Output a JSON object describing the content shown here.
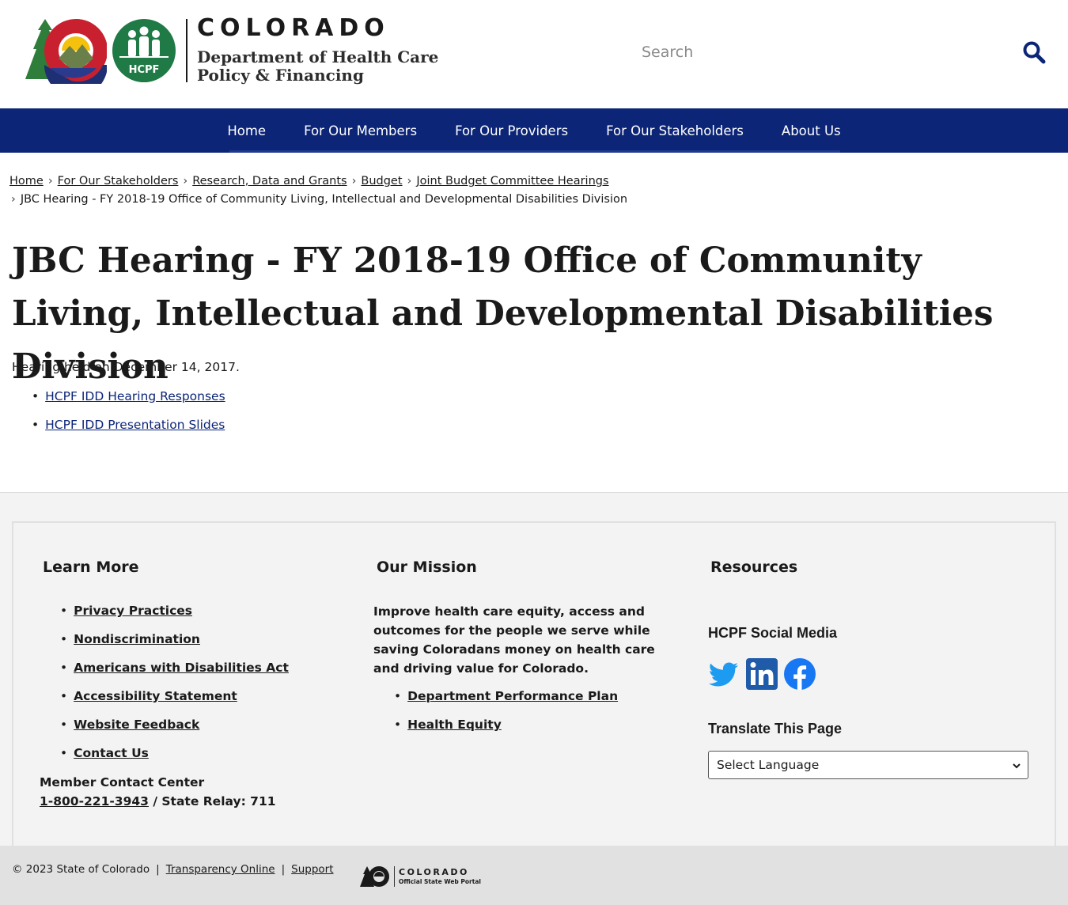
{
  "header": {
    "state_name": "COLORADO",
    "dept_line1": "Department of Health Care",
    "dept_line2": "Policy & Financing",
    "hcpf_badge": "HCPF",
    "search_placeholder": "Search"
  },
  "nav": {
    "items": [
      "Home",
      "For Our Members",
      "For Our Providers",
      "For Our Stakeholders",
      "About Us"
    ]
  },
  "breadcrumb": {
    "links": [
      "Home",
      "For Our Stakeholders",
      "Research, Data and Grants",
      "Budget",
      "Joint Budget Committee Hearings"
    ],
    "current": "JBC Hearing - FY 2018-19 Office of Community Living, Intellectual and Developmental Disabilities Division",
    "separator": "›"
  },
  "main": {
    "title": "JBC Hearing - FY 2018-19 Office of Community Living, Intellectual and Developmental Disabilities Division",
    "intro": "Hearing held on December 14, 2017.",
    "documents": [
      "HCPF IDD Hearing Responses",
      "HCPF IDD Presentation Slides"
    ]
  },
  "footer": {
    "learn_more": {
      "heading": "Learn More",
      "links": [
        "Privacy Practices",
        "Nondiscrimination",
        "Americans with Disabilities Act",
        "Accessibility Statement",
        "Website Feedback",
        "Contact Us"
      ],
      "contact_label": "Member Contact Center",
      "contact_phone": "1-800-221-3943",
      "contact_relay": " / State Relay: 711"
    },
    "mission": {
      "heading": "Our Mission",
      "text": "Improve health care equity, access and outcomes for the people we serve while saving Coloradans money on health care and driving value for Colorado.",
      "links": [
        "Department Performance Plan",
        "Health Equity"
      ]
    },
    "resources": {
      "heading": "Resources",
      "social_heading": "HCPF Social Media",
      "social_icons": [
        "twitter-icon",
        "linkedin-icon",
        "facebook-icon"
      ],
      "translate_heading": "Translate This Page",
      "language_selected": "Select Language"
    }
  },
  "bottom": {
    "copyright": "© 2023 State of Colorado",
    "links": [
      "Transparency Online",
      "Support"
    ],
    "portal_state": "COLORADO",
    "portal_sub": "Official State Web Portal"
  },
  "colors": {
    "nav_bg": "#0c2577",
    "link": "#0c2577",
    "footer_bg": "#f3f3f3",
    "bottom_bg": "#e1e1e1",
    "hcpf_green": "#1f7a45",
    "social_blue": "#1d9bf0"
  }
}
